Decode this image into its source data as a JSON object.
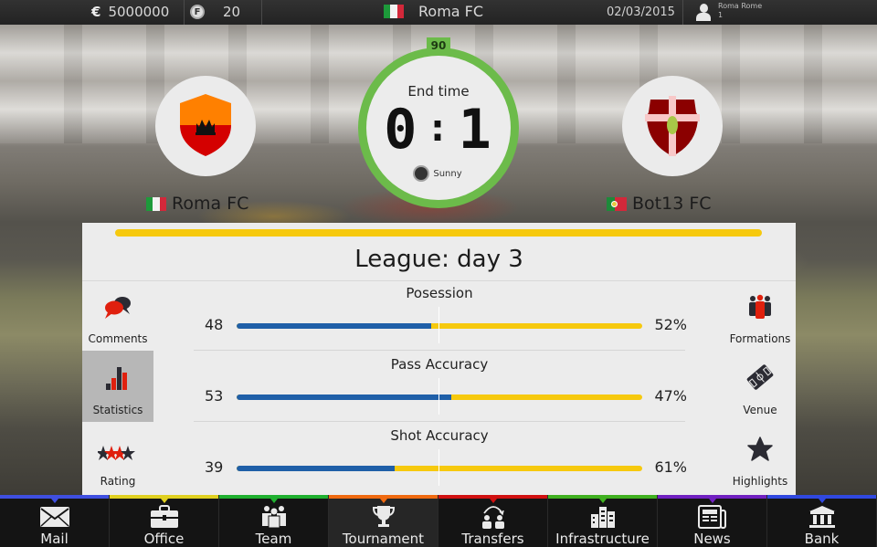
{
  "topbar": {
    "currency_symbol": "€",
    "money": "5000000",
    "fans_icon_letter": "F",
    "fans": "20",
    "club_name": "Roma FC",
    "date": "02/03/2015",
    "user_name": "Roma Rome",
    "user_sub": "1"
  },
  "match": {
    "minute": "90",
    "status": "End time",
    "home_score": "0",
    "away_score": "1",
    "separator": ":",
    "weather": "Sunny",
    "home": {
      "name": "Roma FC",
      "flag": "italy",
      "crest_colors": [
        "#ff8000",
        "#d40000"
      ]
    },
    "away": {
      "name": "Bot13 FC",
      "flag": "portugal",
      "crest_colors": [
        "#8b0000",
        "#f8c8c8",
        "#a8c848"
      ]
    },
    "clock_color": "#6cbb4a"
  },
  "panel": {
    "title": "League: day 3",
    "left_menu": [
      {
        "label": "Comments",
        "icon": "speech-bubbles-icon",
        "active": false
      },
      {
        "label": "Statistics",
        "icon": "bar-chart-icon",
        "active": true
      },
      {
        "label": "Rating",
        "icon": "stars-icon",
        "active": false
      }
    ],
    "right_menu": [
      {
        "label": "Formations",
        "icon": "players-icon"
      },
      {
        "label": "Venue",
        "icon": "pitch-icon"
      },
      {
        "label": "Highlights",
        "icon": "star-icon"
      }
    ],
    "stats": [
      {
        "title": "Posession",
        "home_value": "48",
        "away_value": "52%",
        "home_fraction": 0.48
      },
      {
        "title": "Pass Accuracy",
        "home_value": "53",
        "away_value": "47%",
        "home_fraction": 0.53
      },
      {
        "title": "Shot Accuracy",
        "home_value": "39",
        "away_value": "61%",
        "home_fraction": 0.39
      }
    ],
    "colors": {
      "home": "#1f5fa8",
      "away": "#f6c90e"
    }
  },
  "nav": {
    "items": [
      {
        "label": "Mail",
        "icon": "mail-icon",
        "color": "#3f4fe0",
        "active": false
      },
      {
        "label": "Office",
        "icon": "briefcase-icon",
        "color": "#e0d020",
        "active": false
      },
      {
        "label": "Team",
        "icon": "team-icon",
        "color": "#20b030",
        "active": false
      },
      {
        "label": "Tournament",
        "icon": "trophy-icon",
        "color": "#f06a10",
        "active": true
      },
      {
        "label": "Transfers",
        "icon": "transfers-icon",
        "color": "#d01010",
        "active": false
      },
      {
        "label": "Infrastructure",
        "icon": "buildings-icon",
        "color": "#40b020",
        "active": false
      },
      {
        "label": "News",
        "icon": "newspaper-icon",
        "color": "#7020c0",
        "active": false
      },
      {
        "label": "Bank",
        "icon": "bank-icon",
        "color": "#3048e0",
        "active": false
      }
    ]
  }
}
